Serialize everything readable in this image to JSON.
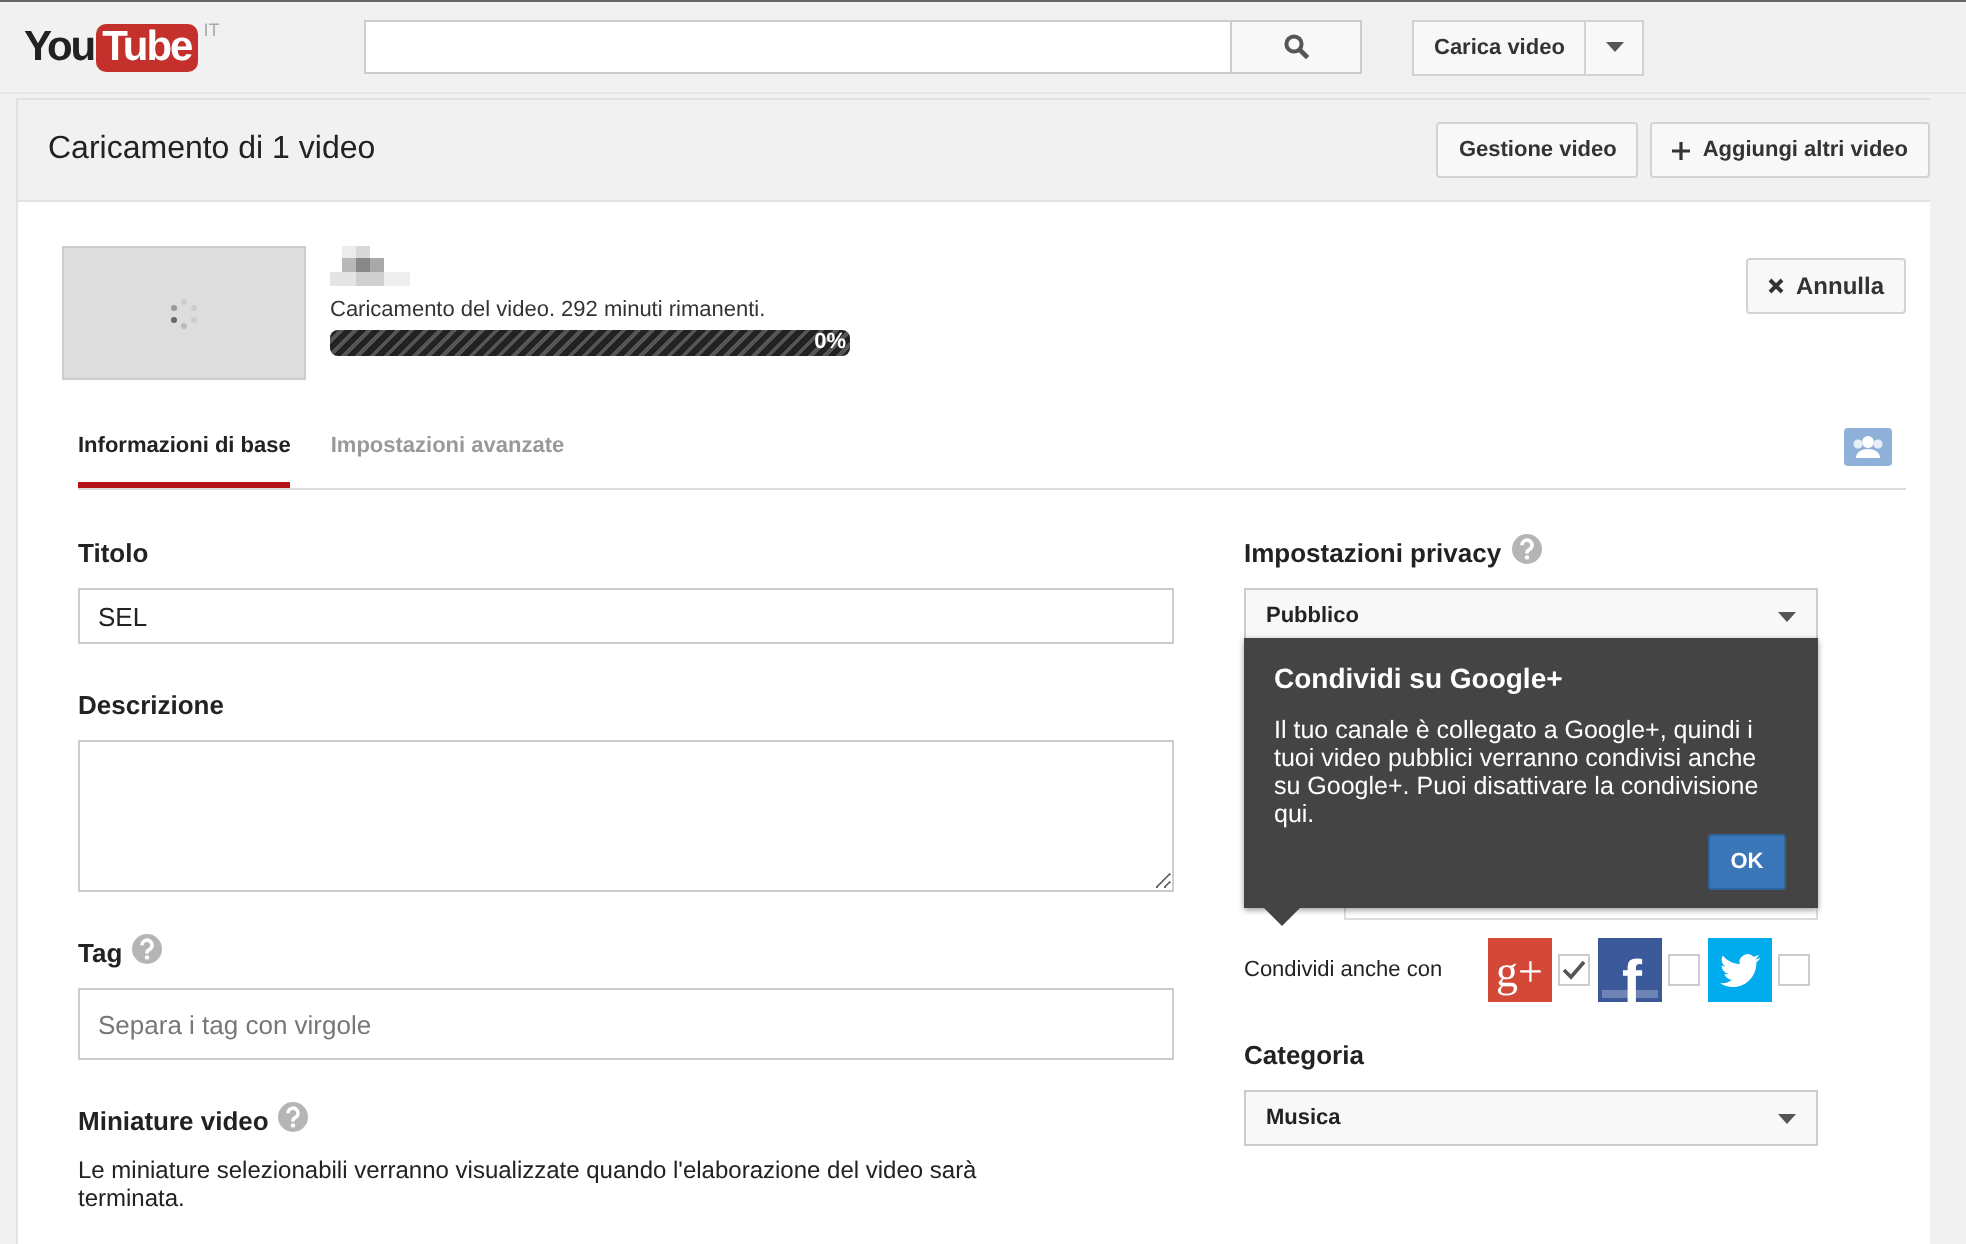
{
  "masthead": {
    "logo_text": "You",
    "logo_box": "Tube",
    "region": "IT",
    "upload_button": "Carica video"
  },
  "panel_header": {
    "title": "Caricamento di 1 video",
    "buttons": [
      {
        "kind": "plain",
        "label": "Gestione video"
      },
      {
        "kind": "add",
        "label": "Aggiungi altri video"
      }
    ]
  },
  "upload": {
    "status": "Caricamento del video. 292 minuti rimanenti.",
    "level": 0,
    "reading": "0%",
    "cancel": "Annulla"
  },
  "tabs": [
    {
      "label": "Informazioni di base",
      "selected": true
    },
    {
      "label": "Impostazioni avanzate",
      "selected": false
    }
  ],
  "fields": [
    {
      "kind": "input",
      "label": "Titolo",
      "help": false,
      "value": "SEL"
    },
    {
      "kind": "textarea",
      "label": "Descrizione",
      "help": false
    },
    {
      "kind": "input",
      "label": "Tag",
      "help": true,
      "placeholder": "Separa i tag con virgole"
    },
    {
      "kind": "text",
      "label": "Miniature video",
      "help": true,
      "text": "Le miniature selezionabili verranno visualizzate quando l'elaborazione del video sarà terminata."
    }
  ],
  "privacy": {
    "label": "Impostazioni privacy",
    "help": true,
    "value": "Pubblico",
    "share_label": "Condividi anche con",
    "networks": [
      {
        "kind": "googleplus",
        "glyph": "g+",
        "checked": true
      },
      {
        "kind": "facebook",
        "glyph": "f",
        "checked": false
      },
      {
        "kind": "twitter",
        "checked": false
      }
    ]
  },
  "category": {
    "label": "Categoria",
    "value": "Musica"
  },
  "tooltip": {
    "title": "Condividi su Google+",
    "text": "Il tuo canale è collegato a Google+, quindi i tuoi video pubblici verranno condivisi anche su Google+. Puoi disattivare la condivisione qui.",
    "button": "OK"
  }
}
